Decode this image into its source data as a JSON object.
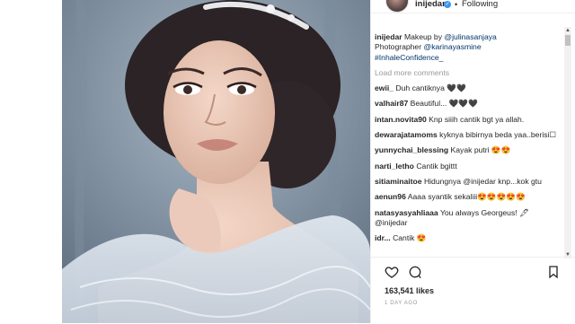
{
  "post": {
    "username": "inijedar",
    "verified_glyph": "✓",
    "dot": "•",
    "following_label": "Following"
  },
  "caption": {
    "username": "inijedar",
    "text_line1": "Makeup by",
    "mention1": "@julinasanjaya",
    "text_line2": "Photographer",
    "mention2": "@karinayasmine",
    "hashtag": "#InhaleConfidence_"
  },
  "load_more_label": "Load more comments",
  "comments": [
    {
      "user": "ewii_",
      "text": "Duh cantiknya 🖤🖤"
    },
    {
      "user": "valhair87",
      "text": "Beautiful... 🖤🖤🖤"
    },
    {
      "user": "intan.novita90",
      "text": "Knp siiih cantik bgt ya allah."
    },
    {
      "user": "dewarajatamoms",
      "text": "kyknya bibirnya beda yaa..berisi☐"
    },
    {
      "user": "yunnychai_blessing",
      "text": "Kayak putri 😍😍"
    },
    {
      "user": "narti_letho",
      "text": "Cantik bgittt"
    },
    {
      "user": "sitiaminaitoe",
      "text": "Hidungnya @inijedar knp...kok gtu"
    },
    {
      "user": "aenun96",
      "text": "Aaaa syantik sekaliii😍😍😍😍😍"
    },
    {
      "user": "natasyasyahliaaa",
      "text": "You always Georgeus! 🖋 @inijedar"
    },
    {
      "user": "idr...",
      "text": "Cantik 😍"
    }
  ],
  "likes_label": "163,541 likes",
  "date_label": "1 DAY AGO",
  "icons": {
    "like": "heart-icon",
    "comment": "comment-icon",
    "save": "bookmark-icon"
  },
  "colors": {
    "text": "#262626",
    "muted": "#999999",
    "mention": "#003569",
    "verified": "#3897f0",
    "border": "#efefef"
  }
}
